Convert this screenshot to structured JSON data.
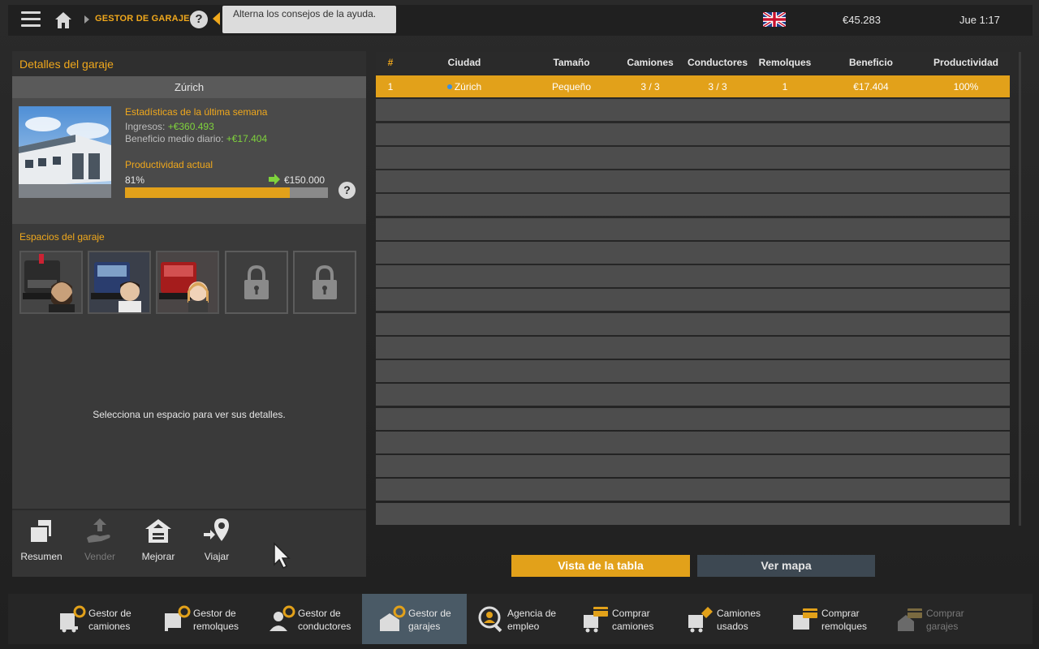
{
  "colors": {
    "accent": "#e2a11a",
    "accent_text": "#f0a81c",
    "positive": "#7fd33c",
    "active_nav": "#4a5a66"
  },
  "topbar": {
    "menu_icon": "hamburger-icon",
    "home_icon": "home-icon",
    "breadcrumb": "GESTOR DE GARAJES",
    "help": "?",
    "tooltip": "Alterna los consejos de la ayuda.",
    "flag_icon": "uk-flag-icon",
    "money": "€45.283",
    "clock": "Jue 1:17"
  },
  "details": {
    "title": "Detalles del garaje",
    "city": "Zúrich",
    "stats_title": "Estadísticas de la última semana",
    "income_label": "Ingresos:",
    "income_value": "+€360.493",
    "avg_label": "Beneficio medio diario:",
    "avg_value": "+€17.404",
    "prod_title": "Productividad actual",
    "prod_pct": "81%",
    "prod_fraction": 0.81,
    "prod_next": "€150.000",
    "prod_help": "?",
    "spaces_title": "Espacios del garaje",
    "select_msg": "Selecciona un espacio para ver sus detalles."
  },
  "actions": [
    {
      "label": "Resumen",
      "icon": "summary-icon",
      "enabled": true
    },
    {
      "label": "Vender",
      "icon": "sell-icon",
      "enabled": false
    },
    {
      "label": "Mejorar",
      "icon": "upgrade-icon",
      "enabled": true
    },
    {
      "label": "Viajar",
      "icon": "travel-icon",
      "enabled": true
    }
  ],
  "table": {
    "headers": [
      "#",
      "Ciudad",
      "Tamaño",
      "Camiones",
      "Conductores",
      "Remolques",
      "Beneficio",
      "Productividad"
    ],
    "rows": [
      [
        "1",
        "Zúrich",
        "Pequeño",
        "3 / 3",
        "3 / 3",
        "1",
        "€17.404",
        "100%"
      ]
    ],
    "empty_rows": 18
  },
  "buttons": {
    "table_view": "Vista de la tabla",
    "map_view": "Ver mapa"
  },
  "bottom_nav": [
    {
      "line1": "Gestor de",
      "line2": "camiones",
      "icon": "truck-manager-icon",
      "active": false,
      "enabled": true
    },
    {
      "line1": "Gestor de",
      "line2": "remolques",
      "icon": "trailer-manager-icon",
      "active": false,
      "enabled": true
    },
    {
      "line1": "Gestor de",
      "line2": "conductores",
      "icon": "driver-manager-icon",
      "active": false,
      "enabled": true
    },
    {
      "line1": "Gestor de",
      "line2": "garajes",
      "icon": "garage-manager-icon",
      "active": true,
      "enabled": true
    },
    {
      "line1": "Agencia de",
      "line2": "empleo",
      "icon": "recruitment-icon",
      "active": false,
      "enabled": true
    },
    {
      "line1": "Comprar",
      "line2": "camiones",
      "icon": "buy-trucks-icon",
      "active": false,
      "enabled": true
    },
    {
      "line1": "Camiones",
      "line2": "usados",
      "icon": "used-trucks-icon",
      "active": false,
      "enabled": true
    },
    {
      "line1": "Comprar",
      "line2": "remolques",
      "icon": "buy-trailers-icon",
      "active": false,
      "enabled": true
    },
    {
      "line1": "Comprar",
      "line2": "garajes",
      "icon": "buy-garages-icon",
      "active": false,
      "enabled": false
    }
  ]
}
